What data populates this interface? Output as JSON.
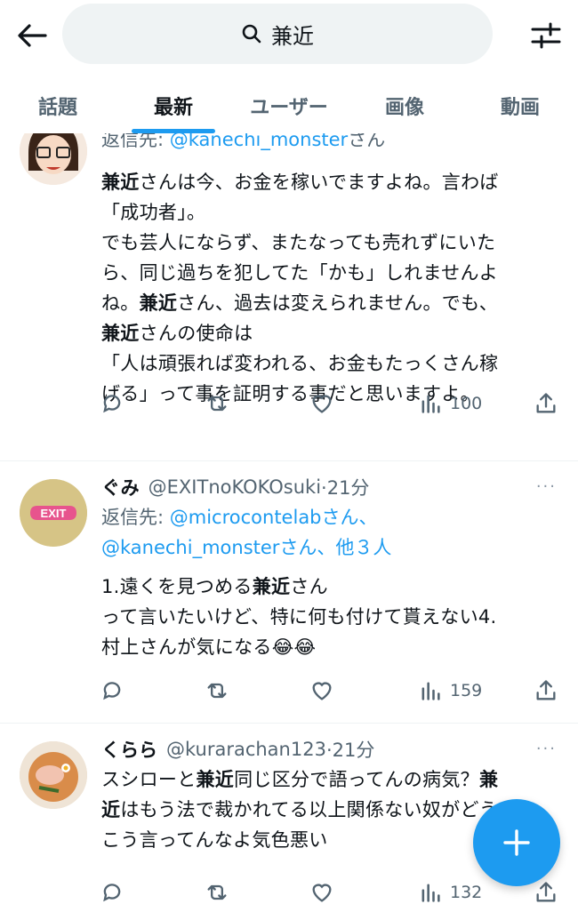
{
  "header": {
    "search_query": "兼近",
    "back_icon": "arrow-left-icon",
    "filter_icon": "sliders-icon"
  },
  "tabs": [
    {
      "label": "話題",
      "active": false
    },
    {
      "label": "最新",
      "active": true
    },
    {
      "label": "ユーザー",
      "active": false
    },
    {
      "label": "画像",
      "active": false
    },
    {
      "label": "動画",
      "active": false
    }
  ],
  "tweets": [
    {
      "reply_prefix": "返信先: ",
      "reply_handles": "@kanechi_monster",
      "reply_suffix": "さん",
      "lines": [
        {
          "b": "兼近",
          "t": "さんは今、お金を稼いでますよね。言わば"
        },
        {
          "b": "",
          "t": "「成功者」。"
        },
        {
          "b": "",
          "t": "でも芸人にならず、またなっても売れずにいた"
        },
        {
          "b": "",
          "t": "ら、同じ過ちを犯してた「かも」しれませんよ"
        },
        {
          "b": "",
          "t": "ね。",
          "b2": "兼近",
          "t2": "さん、過去は変えられません。でも、"
        },
        {
          "b": "兼近",
          "t": "さんの使命は"
        },
        {
          "b": "",
          "t": "「人は頑張れば変われる、お金もたっくさん稼"
        },
        {
          "b": "",
          "t": "げる」って事を証明する事だと思いますよ。"
        }
      ],
      "views": "100"
    },
    {
      "name": "ぐみ",
      "handle": "@EXITnoKOKOsuki",
      "time": "·21分",
      "avatar_text": "EXIT",
      "reply_prefix": "返信先: ",
      "reply_handles": "@microcontelab",
      "reply_suffix": "さん、",
      "reply_handles2": "@kanechi_monster",
      "reply_suffix2": "さん、他３人",
      "line1_pre": "1.遠くを見つめる",
      "line1_b": "兼近",
      "line1_post": "さん",
      "line2": "って言いたいけど、特に何も付けて貰えない4.",
      "line3": "村上さんが気になる😂😂",
      "views": "159"
    },
    {
      "name": "くらら",
      "handle": "@kurarachan123",
      "time": "·21分",
      "line1_pre": "スシローと",
      "line1_b": "兼近",
      "line1_post": "同じ区分で語ってんの病気？",
      "line1_b2": "兼",
      "line2_b": "近",
      "line2_post": "はもう法で裁かれてる以上関係ない奴がどう",
      "line3": "こう言ってんなよ気色悪い",
      "views": "132"
    }
  ],
  "more_label": "···",
  "fab_icon": "plus-icon",
  "colors": {
    "accent": "#1d9bf0",
    "muted": "#536471",
    "text": "#0f1419"
  }
}
